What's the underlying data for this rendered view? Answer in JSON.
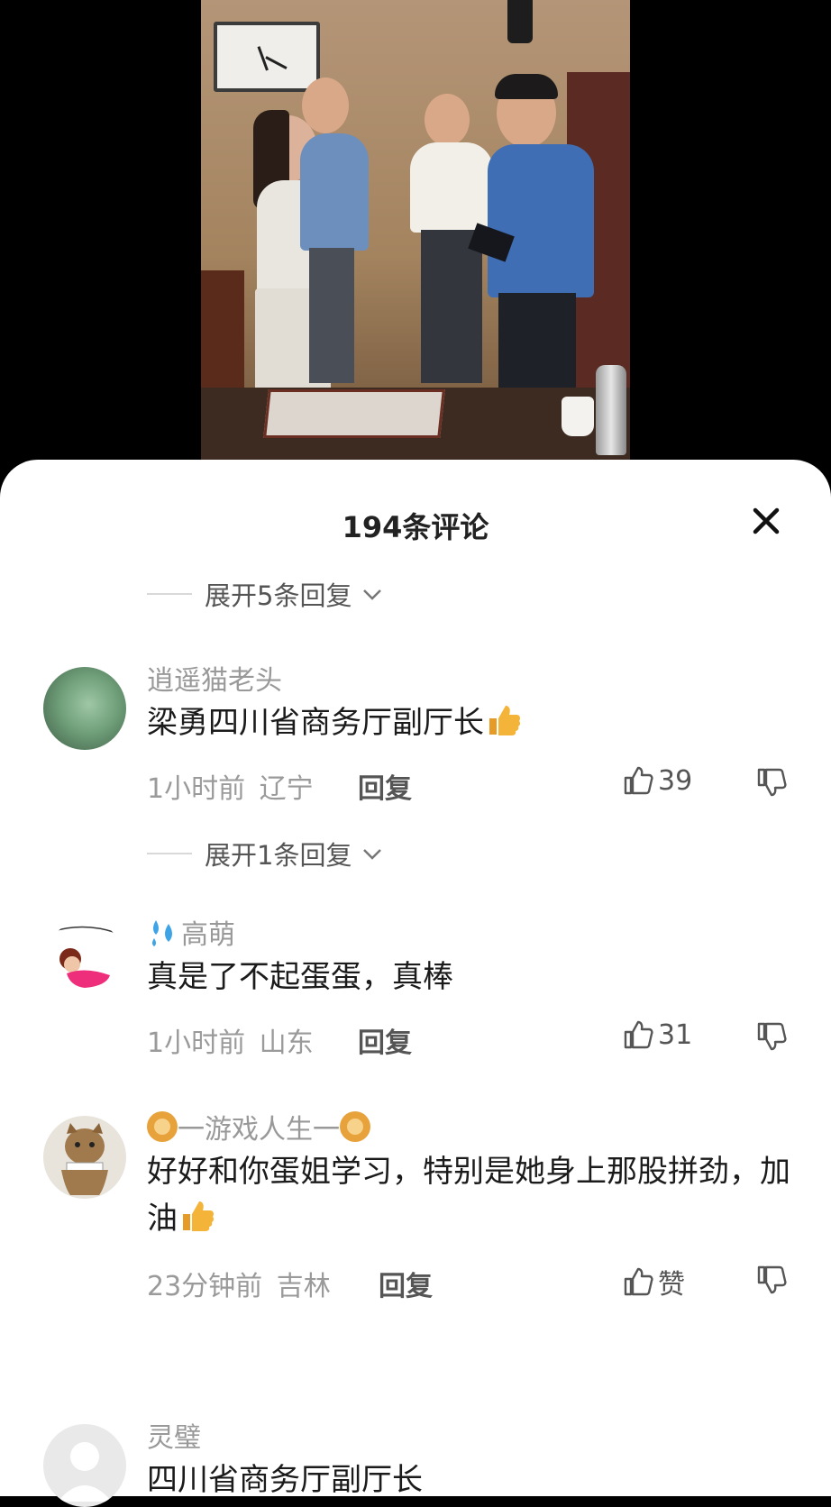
{
  "sheet": {
    "title": "194条评论"
  },
  "expand_top": {
    "label": "展开5条回复"
  },
  "comments": [
    {
      "name": "逍遥猫老头",
      "text": "梁勇四川省商务厅副厅长",
      "time": "1小时前",
      "location": "辽宁",
      "reply_label": "回复",
      "likes": "39",
      "expand_label": "展开1条回复"
    },
    {
      "name": "高萌",
      "text": "真是了不起蛋蛋，真棒",
      "time": "1小时前",
      "location": "山东",
      "reply_label": "回复",
      "likes": "31"
    },
    {
      "name": "一游戏人生一",
      "text": "好好和你蛋姐学习，特别是她身上那股拼劲，加油",
      "time": "23分钟前",
      "location": "吉林",
      "reply_label": "回复",
      "likes": "赞"
    },
    {
      "name": "灵璧",
      "text": "四川省商务厅副厅长"
    }
  ],
  "icons": {
    "close": "close-icon",
    "like": "thumbs-up-icon",
    "dislike": "thumbs-down-icon",
    "chevron": "chevron-down-icon"
  },
  "colors": {
    "like_emoji": "#f4b43a",
    "text_primary": "#1b1b1b",
    "text_secondary": "#9a9a9a"
  }
}
